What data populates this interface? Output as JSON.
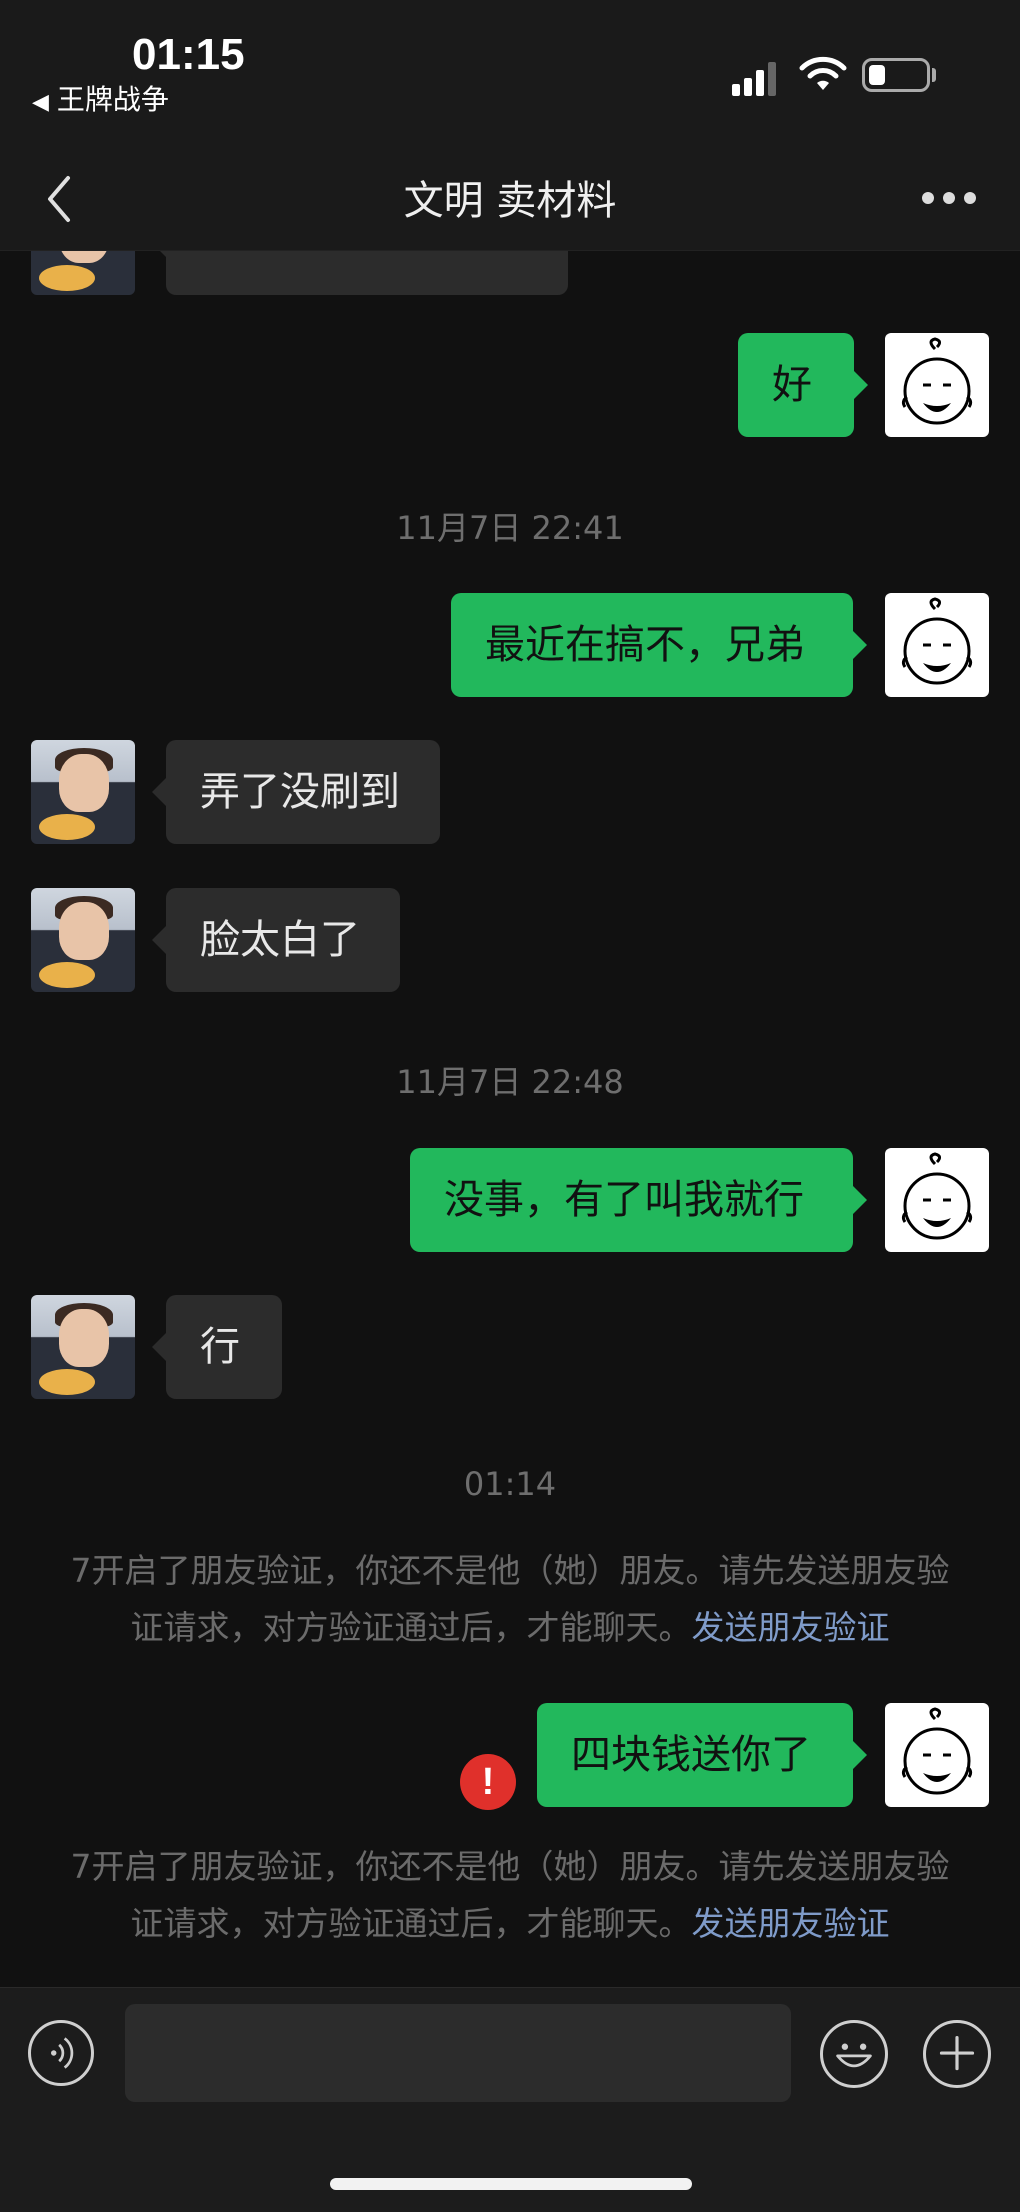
{
  "status_bar": {
    "time": "01:15",
    "back_app_label": "王牌战争"
  },
  "header": {
    "title": "文明 卖材料"
  },
  "messages": {
    "m1": "好",
    "t1": "11月7日 22:41",
    "m2": "最近在搞不，兄弟",
    "m3": "弄了没刷到",
    "m4": "脸太白了",
    "t2": "11月7日 22:48",
    "m5": "没事，有了叫我就行",
    "m6": "行",
    "t3": "01:14",
    "sys1_text": "7开启了朋友验证，你还不是他（她）朋友。请先发送朋友验证请求，对方验证通过后，才能聊天。",
    "sys1_link": "发送朋友验证",
    "m7": "四块钱送你了",
    "m7_error": "!",
    "sys2_text": "7开启了朋友验证，你还不是他（她）朋友。请先发送朋友验证请求，对方验证通过后，才能聊天。",
    "sys2_link": "发送朋友验证"
  },
  "input": {
    "value": "",
    "placeholder": ""
  },
  "icons": {
    "back": "chevron-left-icon",
    "more": "more-dots-icon",
    "voice": "voice-icon",
    "emoji": "emoji-icon",
    "plus": "plus-icon",
    "error": "error-icon"
  },
  "colors": {
    "accent": "#22b85c",
    "background": "#111111",
    "incoming_bubble": "#2c2c2c",
    "link": "#7f9bc9",
    "error": "#e0302b"
  }
}
